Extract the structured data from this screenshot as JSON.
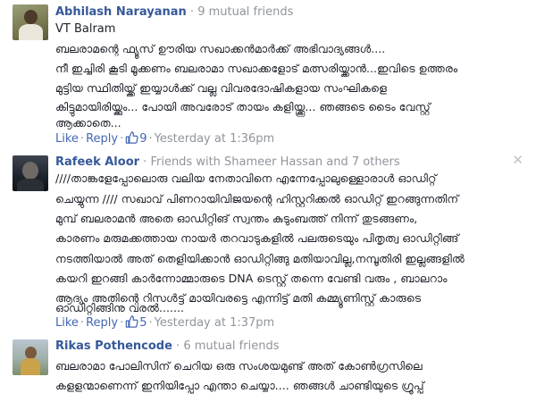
{
  "comments": [
    {
      "author": "Abhilash Narayanan",
      "meta": "9 mutual friends",
      "lines": [
        "VT Balram",
        "ബലരാമന്റെ ഫ്യൂസ് ഊരിയ സഖാക്കൻമാർക്ക് അഭിവാദ്യങ്ങൾ....",
        "നീ ഇച്ചിരി കൂടി മൂക്കണം ബലരാമാ സഖാക്കളോട് മത്സരിയ്ക്കാൻ...ഇവിടെ ഉത്തരം",
        "മുട്ടിയ സ്ഥിതിയ്ക്ക് ഇയ്യാൾക്ക് വല്ല വിവരദോഷികളായ സംഘികളെ",
        "കിട്ടുമായിരിയ്ക്കും... പോയി അവരോട് തായം കളിയ്ക്കൂ... ഞങ്ങടെ ടൈം വേസ്റ്റ്",
        "ആക്കാതെ..."
      ],
      "like_label": "Like",
      "reply_label": "Reply",
      "like_count": "9",
      "timestamp": "Yesterday at 1:36pm"
    },
    {
      "author": "Rafeek Aloor",
      "meta": "Friends with Shameer Hassan and 7 others",
      "lines": [
        "////താങ്കളേപ്പോലൊരു വലിയ നേതാവിനെ എന്നേപ്പോലുള്ളൊരാൾ ഓഡിറ്റ്",
        "ചെയ്യുന്ന //// സഖാവ് പിണറായിവിജയന്റെ ഹിസ്റ്ററിക്കൽ ഓഡിറ്റ് ഇറങ്ങുന്നതിന്",
        "മുമ്പ് ബലരാമൻ അതെ ഓഡിറ്റിങ് സ്വന്തം കുടുംബത്ത് നിന്ന് തുടങ്ങണം,",
        "കാരണം മരുമക്കത്തായ നായർ തറവാടുകളിൽ പലരുടെയും പിതൃത്വ ഓഡിറ്റിങ്ങ്",
        "നടത്തിയാൽ അത് തെളിയിക്കാൻ ഓഡിറ്റിങ്ങു മതിയാവില്ല,നമ്പൂതിരി ഇല്ലങ്ങളിൽ",
        "കയറി ഇറങ്ങി കാർന്നോമ്മാരുടെ DNA ടെസ്റ്റ് തന്നെ വേണ്ടി വരും , ബാലറാം",
        "ആദ്യം അതിന്റെ റിസൾട്ട് മായിവരട്ടെ എന്നിട്ട് മതി കമ്മ്യൂണിസ്റ്റ് കാരുടെ",
        "ഓഡിറ്റിങ്ങിനു വരൽ......."
      ],
      "like_label": "Like",
      "reply_label": "Reply",
      "like_count": "5",
      "timestamp": "Yesterday at 1:37pm",
      "close_glyph": "✕"
    },
    {
      "author": "Rikas Pothencode",
      "meta": "6 mutual friends",
      "lines": [
        "ബലരാമാ പോലിസിന് ചെറിയ ഒരു സംശയമുണ്ട് അത് കോൺഗ്രസിലെ",
        "കളളന്മാണെന്ന് ഇനിയിപ്പോ എന്താ ചെയ്യാ.... ഞങ്ങൾ ചാണ്ടിയുടെ ഗ്രൂപ്പ്"
      ]
    }
  ],
  "separator": " · ",
  "dot": "·",
  "colors": {
    "link": "#365899",
    "action": "#4267b2",
    "meta": "#90949c",
    "text": "#1d2129"
  }
}
